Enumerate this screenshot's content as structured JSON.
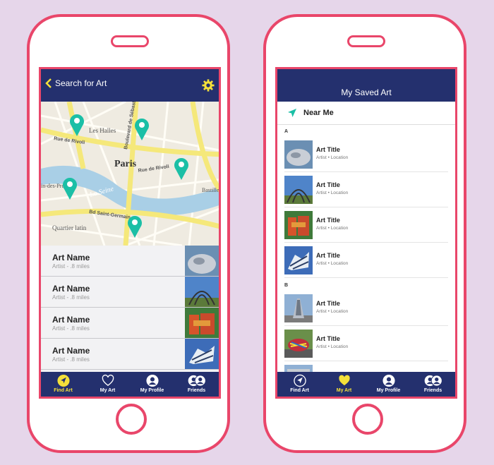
{
  "left": {
    "header": {
      "back_label": "Search for Art"
    },
    "map": {
      "labels": [
        "Les Halles",
        "Rue de Rivoli",
        "Boulevard de Sébastopol",
        "Paris",
        "Rue de Rivoli",
        "Bastille",
        "La Seine",
        "Bd Saint-Germain",
        "Quartier latin",
        "in-des-Prés"
      ]
    },
    "results": [
      {
        "name": "Art Name",
        "sub": "Artist - .8 miles"
      },
      {
        "name": "Art Name",
        "sub": "Artist - .8 miles"
      },
      {
        "name": "Art Name",
        "sub": "Artist - .8 miles"
      },
      {
        "name": "Art Name",
        "sub": "Artist - .8 miles"
      }
    ],
    "tabs": [
      "Find Art",
      "My Art",
      "My Profile",
      "Friends"
    ],
    "active_tab": "Find Art"
  },
  "right": {
    "header": {
      "title": "My Saved Art"
    },
    "near_me": "Near Me",
    "sections": [
      {
        "letter": "A",
        "items": [
          {
            "title": "Art Title",
            "sub": "Artist • Location"
          },
          {
            "title": "Art Title",
            "sub": "Artist • Location"
          },
          {
            "title": "Art Title",
            "sub": "Artist • Location"
          },
          {
            "title": "Art Title",
            "sub": "Artist • Location"
          }
        ]
      },
      {
        "letter": "B",
        "items": [
          {
            "title": "Art Title",
            "sub": "Artist • Location"
          },
          {
            "title": "Art Title",
            "sub": "Artist • Location"
          }
        ]
      }
    ],
    "tabs": [
      "Find Art",
      "My Art",
      "My Profile",
      "Friends"
    ],
    "active_tab": "My Art"
  },
  "colors": {
    "navy": "#24306e",
    "frame": "#e9466a",
    "accent_yellow": "#f4e03a",
    "pin_teal": "#1bbfa6",
    "background": "#e6d6ea"
  }
}
